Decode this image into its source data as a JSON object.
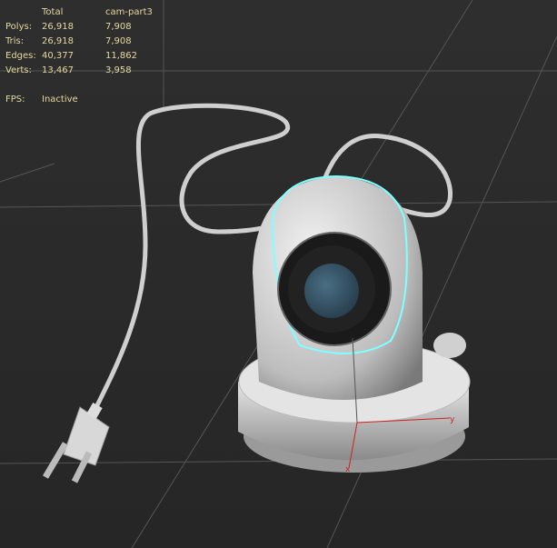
{
  "stats": {
    "headers": [
      "Total",
      "cam-part3"
    ],
    "rows": [
      {
        "label": "Polys:",
        "total": "26,918",
        "selected": "7,908"
      },
      {
        "label": "Tris:",
        "total": "26,918",
        "selected": "7,908"
      },
      {
        "label": "Edges:",
        "total": "40,377",
        "selected": "11,862"
      },
      {
        "label": "Verts:",
        "total": "13,467",
        "selected": "3,958"
      }
    ],
    "fps_label": "FPS:",
    "fps_value": "Inactive"
  },
  "colors": {
    "text": "#e6d8a0",
    "selection": "#7fffff",
    "gizmo_x": "#cc2222"
  }
}
